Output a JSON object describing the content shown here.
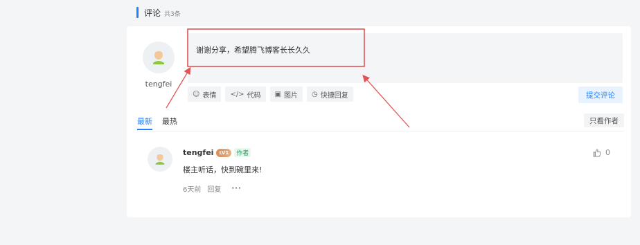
{
  "section": {
    "title": "评论",
    "count": "共3条"
  },
  "composer": {
    "username": "tengfei",
    "text": "谢谢分享，希望腾飞博客长长久久",
    "tools": [
      {
        "icon": "emoji-icon",
        "label": "表情"
      },
      {
        "icon": "code-icon",
        "label": "代码"
      },
      {
        "icon": "image-icon",
        "label": "图片"
      },
      {
        "icon": "clock-icon",
        "label": "快捷回复"
      }
    ],
    "submit_label": "提交评论"
  },
  "tabs": [
    {
      "label": "最新",
      "active": true
    },
    {
      "label": "最热",
      "active": false
    }
  ],
  "filter": {
    "only_author": "只看作者"
  },
  "comments": [
    {
      "name": "tengfei",
      "level": "LV1",
      "tag": "作者",
      "text": "楼主听话，快到碗里来!",
      "time": "6天前",
      "reply": "回复",
      "more": "···",
      "likes": "0"
    }
  ],
  "colors": {
    "accent": "#1e80ff",
    "annotation": "#e05555",
    "author_tag": "#1a9c5c"
  }
}
